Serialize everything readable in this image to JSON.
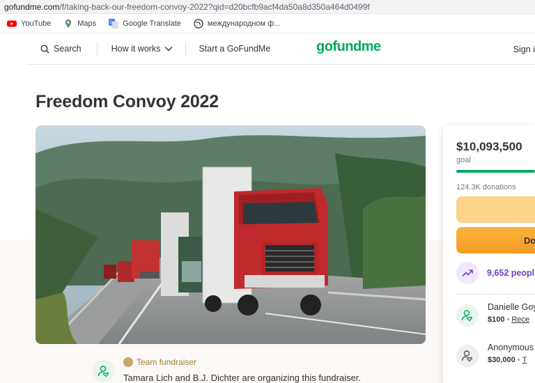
{
  "browser": {
    "url_host": "gofundme.com",
    "url_path": "/f/taking-back-our-freedom-convoy-2022?qid=d20bcfb9acf4da50a8d350a464d0499f",
    "bookmarks": [
      {
        "label": "YouTube",
        "icon": "youtube-icon"
      },
      {
        "label": "Maps",
        "icon": "maps-icon"
      },
      {
        "label": "Google Translate",
        "icon": "translate-icon"
      },
      {
        "label": "международном ф...",
        "icon": "globe-icon"
      }
    ]
  },
  "header": {
    "search": "Search",
    "how_it_works": "How it works",
    "start": "Start a GoFundMe",
    "logo": "gofundme",
    "signin": "Sign i"
  },
  "campaign": {
    "title": "Freedom Convoy 2022",
    "team_label": "Team fundraiser",
    "organizers": "Tamara Lich and B.J. Dichter are organizing this fundraiser."
  },
  "donation_panel": {
    "amount": "$10,093,500",
    "goal_label": "goal",
    "donations": "124.3K donations",
    "donate_label": "Do",
    "trend_text": "9,652 peopl",
    "donors": [
      {
        "name": "Danielle Goy",
        "amount": "$100",
        "link": "Rece"
      },
      {
        "name": "Anonymous",
        "amount": "$30,000",
        "link": "T"
      }
    ]
  },
  "colors": {
    "brand_green": "#02a95c",
    "donate_orange": "#f6a730",
    "share_yellow": "#fdd28a",
    "trend_purple": "#6f3fbf"
  }
}
